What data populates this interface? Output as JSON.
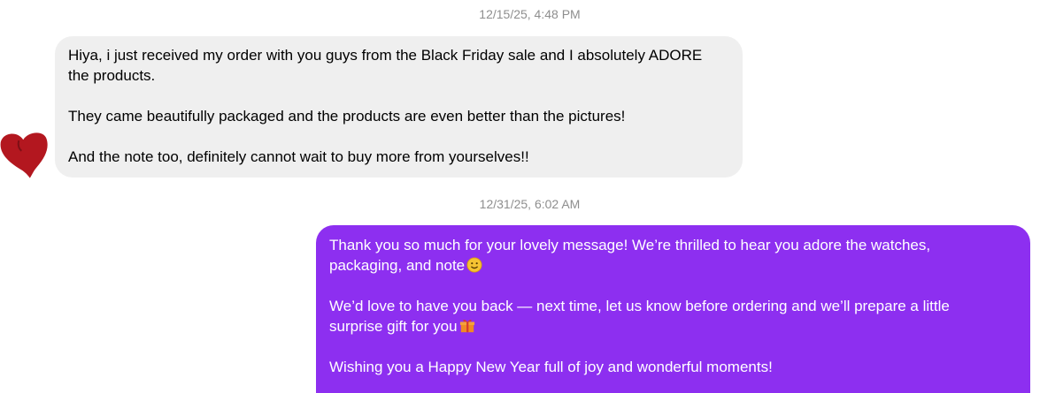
{
  "conversation": {
    "messages": [
      {
        "timestamp": "12/15/25, 4:48 PM",
        "direction": "received",
        "paragraphs": [
          "Hiya, i just received my order with you guys from the Black Friday sale and I absolutely ADORE\nthe products.",
          "They came beautifully packaged and the products are even better than the pictures!",
          "And the note too, definitely cannot wait to buy more from yourselves!!"
        ],
        "reaction": "heart-icon"
      },
      {
        "timestamp": "12/31/25, 6:02 AM",
        "direction": "sent",
        "paragraphs": [
          "Thank you so much for your lovely message! We’re thrilled to hear you adore the watches,\npackaging, and note",
          "We’d love to have you back — next time, let us know before ordering and we’ll prepare a little\nsurprise gift for you",
          "Wishing you a Happy New Year full of joy and wonderful moments!"
        ],
        "emojis": [
          "smiling-face-emoji",
          "gift-emoji"
        ]
      }
    ]
  },
  "colors": {
    "received_bubble": "#efefef",
    "sent_bubble": "#8d2ff0",
    "timestamp_text": "#8e8e8e",
    "heart": "#b3171f"
  }
}
